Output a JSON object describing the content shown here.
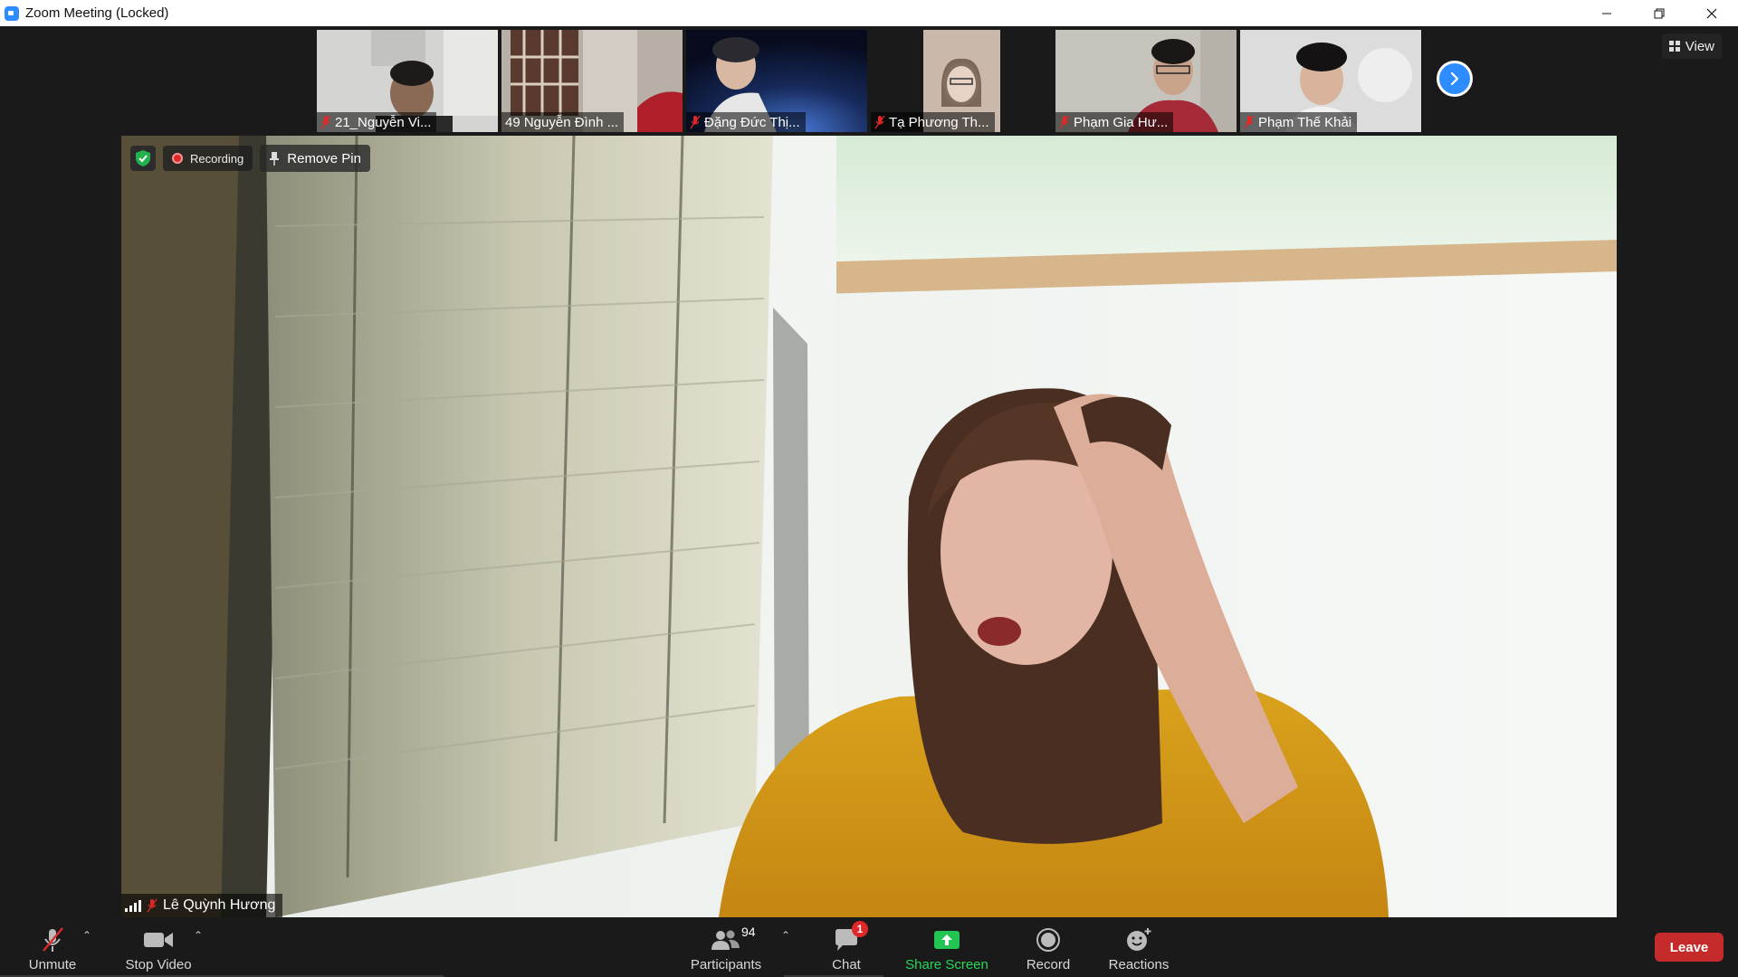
{
  "window": {
    "title": "Zoom Meeting (Locked)",
    "controls": [
      "minimize",
      "restore",
      "close"
    ]
  },
  "header": {
    "view_label": "View"
  },
  "thumbnails": [
    {
      "name": "21_Nguyễn Vi...",
      "muted": true,
      "bg": "#cfcfcf"
    },
    {
      "name": "49 Nguyễn Đình ...",
      "muted": false,
      "bg": "#b9b2aa"
    },
    {
      "name": "Đặng Đức Thị...",
      "muted": true,
      "bg": "#1f3566"
    },
    {
      "name": "Tạ Phương Th...",
      "muted": true,
      "bg": "#1a1a1a"
    },
    {
      "name": "Phạm Gia Hư...",
      "muted": true,
      "bg": "#c8c5c0"
    },
    {
      "name": "Phạm Thế Khải",
      "muted": true,
      "bg": "#d8d8d8"
    }
  ],
  "main": {
    "recording_label": "Recording",
    "remove_pin_label": "Remove Pin",
    "speaker_name": "Lê Quỳnh Hương"
  },
  "toolbar": {
    "unmute_label": "Unmute",
    "stop_video_label": "Stop Video",
    "participants_label": "Participants",
    "participants_count": "94",
    "chat_label": "Chat",
    "chat_badge": "1",
    "share_screen_label": "Share Screen",
    "record_label": "Record",
    "reactions_label": "Reactions",
    "leave_label": "Leave"
  },
  "colors": {
    "zoom_blue": "#2d8cff",
    "share_green": "#23d959",
    "leave_red": "#c62b2b",
    "mute_red": "#e02828"
  }
}
